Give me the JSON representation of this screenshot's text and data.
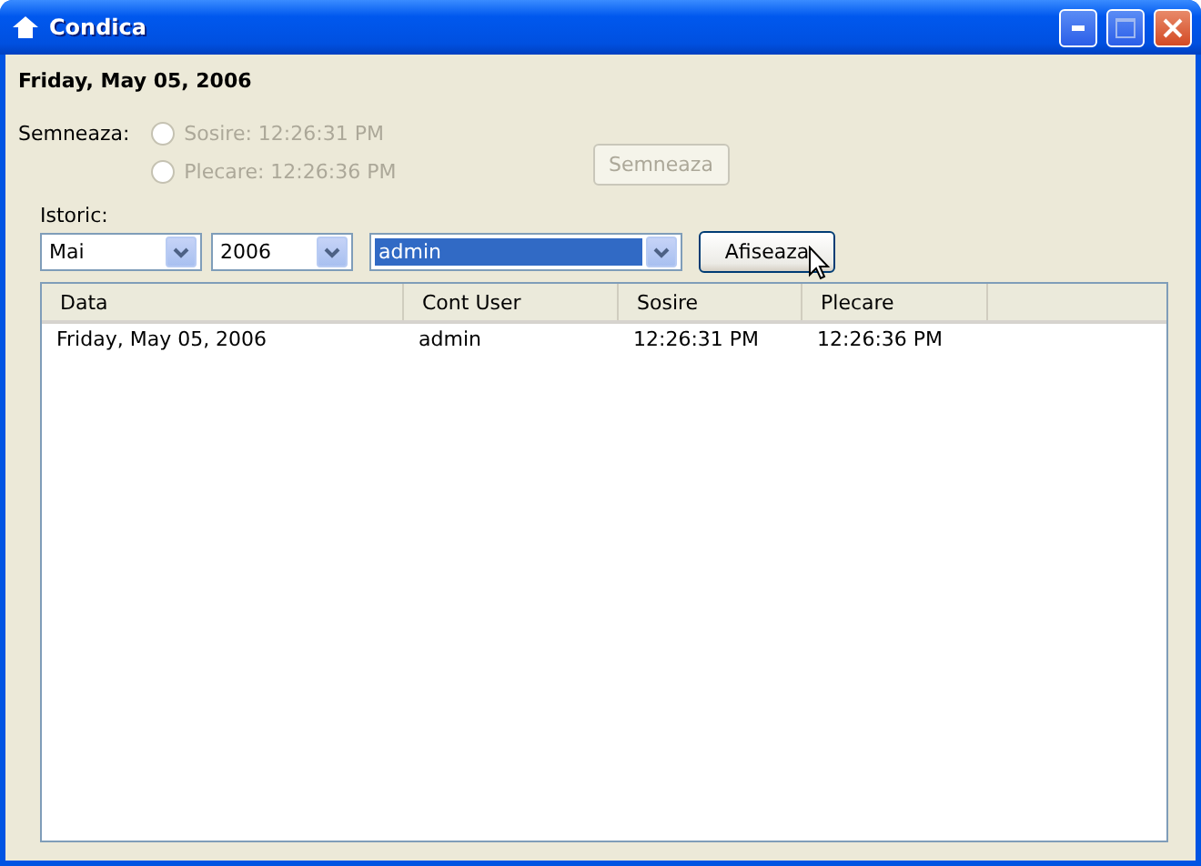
{
  "window": {
    "title": "Condica"
  },
  "date": "Friday, May 05, 2006",
  "sign": {
    "label": "Semneaza:",
    "options": [
      {
        "label": "Sosire: 12:26:31 PM",
        "selected": false,
        "disabled": true
      },
      {
        "label": "Plecare: 12:26:36 PM",
        "selected": false,
        "disabled": true
      }
    ],
    "button": {
      "label": "Semneaza",
      "disabled": true
    }
  },
  "history": {
    "label": "Istoric:",
    "filters": [
      {
        "value": "Mai",
        "highlighted": false
      },
      {
        "value": "2006",
        "highlighted": false
      },
      {
        "value": "admin",
        "highlighted": true
      }
    ],
    "button": {
      "label": "Afiseaza",
      "disabled": false
    }
  },
  "table": {
    "columns": [
      "Data",
      "Cont User",
      "Sosire",
      "Plecare"
    ],
    "rows": [
      [
        "Friday, May 05, 2006",
        "admin",
        "12:26:31 PM",
        "12:26:36 PM"
      ]
    ]
  }
}
